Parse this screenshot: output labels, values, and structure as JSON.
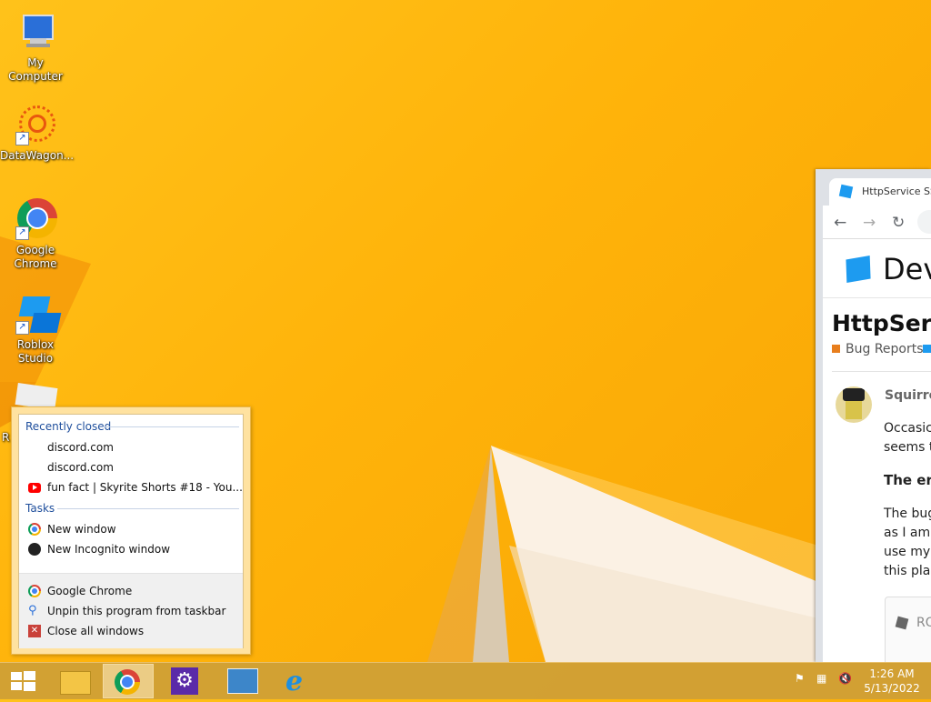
{
  "desktop": {
    "icons": [
      {
        "label": "My Computer",
        "icon": "computer-icon"
      },
      {
        "label": "DataWagon...",
        "icon": "datawagon-icon"
      },
      {
        "label": "Google Chrome",
        "icon": "chrome-icon"
      },
      {
        "label": "Roblox Studio",
        "icon": "roblox-studio-icon"
      },
      {
        "label": "R",
        "icon": "roblox-player-icon"
      }
    ]
  },
  "browser": {
    "tab_title": "HttpService SS",
    "site_header": "Dev",
    "post_title": "HttpServ",
    "categories": [
      "Bug Reports",
      ""
    ],
    "category_colors": [
      "#e87e1d",
      "#1d9bf0"
    ],
    "username": "Squirre",
    "text_lines": [
      "Occasic",
      "seems t"
    ],
    "heading": "The er",
    "body_lines": [
      "The bug",
      "as I am",
      "use my",
      "this plac"
    ],
    "quote_text": "RO"
  },
  "jumplist": {
    "recently_closed_header": "Recently closed",
    "recent": [
      {
        "label": "discord.com",
        "icon": ""
      },
      {
        "label": "discord.com",
        "icon": ""
      },
      {
        "label": "fun fact | Skyrite Shorts #18 - You...",
        "icon": "youtube-icon"
      }
    ],
    "tasks_header": "Tasks",
    "tasks": [
      {
        "label": "New window",
        "icon": "chrome-icon"
      },
      {
        "label": "New Incognito window",
        "icon": "incognito-icon"
      }
    ],
    "bottom": [
      {
        "label": "Google Chrome",
        "icon": "chrome-icon"
      },
      {
        "label": "Unpin this program from taskbar",
        "icon": "unpin-icon"
      },
      {
        "label": "Close all windows",
        "icon": "close-icon"
      }
    ]
  },
  "taskbar": {
    "buttons": [
      "start-button",
      "file-explorer",
      "google-chrome",
      "settings",
      "control-panel",
      "internet-explorer"
    ],
    "time": "1:26 AM",
    "date": "5/13/2022"
  }
}
